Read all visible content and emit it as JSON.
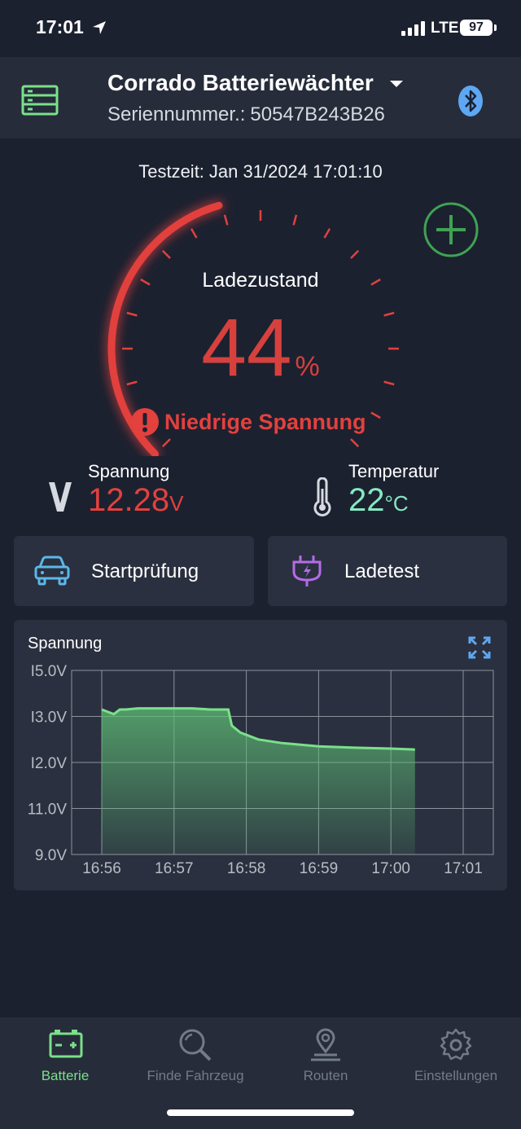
{
  "status": {
    "time": "17:01",
    "network": "LTE",
    "battery": "97"
  },
  "header": {
    "title": "Corrado Batteriewächter",
    "serial_label": "Seriennummer.:",
    "serial_value": "50547B243B26"
  },
  "test": {
    "label": "Testzeit:",
    "datetime": "Jan 31/2024 17:01:10"
  },
  "gauge": {
    "label": "Ladezustand",
    "value": "44",
    "unit": "%",
    "fraction": 0.44,
    "warning": "Niedrige Spannung",
    "color": "#e2413d"
  },
  "metrics": {
    "voltage": {
      "label": "Spannung",
      "value": "12.28",
      "unit": "V"
    },
    "temperature": {
      "label": "Temperatur",
      "value": "22",
      "unit": "°C"
    }
  },
  "actions": {
    "start_test": "Startprüfung",
    "charge_test": "Ladetest"
  },
  "chart_data": {
    "type": "area",
    "title": "Spannung",
    "y_ticks": [
      "I5.0V",
      "I3.0V",
      "I2.0V",
      "11.0V",
      "9.0V"
    ],
    "x_ticks": [
      "16:56",
      "16:57",
      "16:58",
      "16:59",
      "17:00",
      "17:01"
    ],
    "ylim": [
      9.0,
      15.0
    ],
    "series": [
      {
        "color": "#7be08a",
        "x": [
          "16:56:00",
          "16:56:05",
          "16:56:10",
          "16:56:15",
          "16:56:20",
          "16:56:30",
          "16:56:45",
          "16:57:00",
          "16:57:15",
          "16:57:30",
          "16:57:40",
          "16:57:45",
          "16:57:48",
          "16:57:55",
          "16:58:10",
          "16:58:30",
          "16:59:00",
          "16:59:30",
          "17:00:00",
          "17:00:20"
        ],
        "y": [
          13.3,
          13.2,
          13.1,
          13.3,
          13.3,
          13.35,
          13.35,
          13.35,
          13.35,
          13.3,
          13.3,
          13.3,
          12.8,
          12.65,
          12.5,
          12.42,
          12.35,
          12.32,
          12.3,
          12.28
        ]
      }
    ]
  },
  "tabs": [
    {
      "label": "Batterie",
      "active": true
    },
    {
      "label": "Finde Fahrzeug",
      "active": false
    },
    {
      "label": "Routen",
      "active": false
    },
    {
      "label": "Einstellungen",
      "active": false
    }
  ],
  "colors": {
    "accent_green": "#7be08a",
    "danger": "#e2413d",
    "temp": "#86e8c1",
    "bluetooth": "#5ea7f2",
    "plug": "#b46ce8",
    "car": "#5cb7e8"
  }
}
